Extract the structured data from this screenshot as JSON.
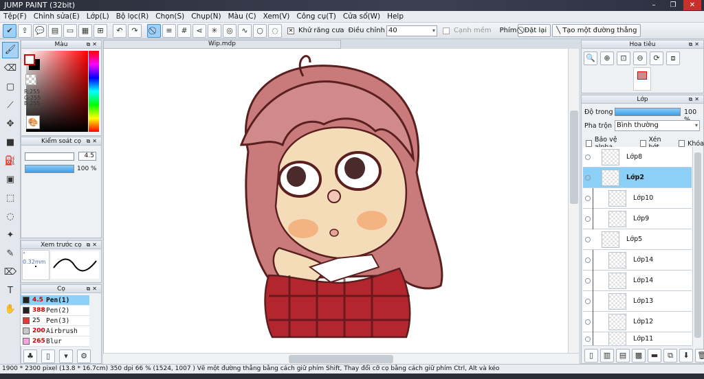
{
  "window": {
    "title": "JUMP PAINT (32bit)",
    "controls": [
      "–",
      "❐",
      "✕"
    ]
  },
  "menu": [
    "Tệp(F)",
    "Chỉnh sửa(E)",
    "Lớp(L)",
    "Bộ lọc(R)",
    "Chọn(S)",
    "Chụp(N)",
    "Màu (C)",
    "Xem(V)",
    "Công cụ(T)",
    "Cửa sổ(W)",
    "Help"
  ],
  "toolbar": {
    "antialias_label": "Khử răng cưa",
    "adjust_label": "Điều chỉnh",
    "adjust_value": "40",
    "edge_label": "Cạnh mềm",
    "key_label": "Phím",
    "reset_label": "Đặt lại",
    "straight_line_label": "Tạo một đường thẳng"
  },
  "color_panel": {
    "title": "Màu",
    "r": "R:255",
    "g": "G:255",
    "b": "B:255"
  },
  "brush_control": {
    "title": "Kiểm soát cọ",
    "size": "4.5",
    "opacity": "100 %",
    "opacity_fraction": 1.0
  },
  "brush_preview": {
    "title": "Xem trước cọ",
    "size_label": "° 0.32mm"
  },
  "brushes": {
    "title": "Cọ",
    "items": [
      {
        "size": "4.5",
        "name": "Pen(1)",
        "color": "#222222",
        "selected": true
      },
      {
        "size": "388",
        "name": "Pen(2)",
        "color": "#222222",
        "selected": false
      },
      {
        "size": "25",
        "name": "Pen(3)",
        "color": "#e23a3a",
        "selected": false
      },
      {
        "size": "200",
        "name": "Airbrush",
        "color": "#c8c8c8",
        "selected": false
      },
      {
        "size": "265",
        "name": "Blur",
        "color": "#f6a6e0",
        "selected": false
      }
    ]
  },
  "document": {
    "tab": "Wip.mdp"
  },
  "navigator": {
    "title": "Hoa tiêu"
  },
  "layers_panel": {
    "title": "Lớp",
    "opacity_label": "Độ trong",
    "opacity_value": "100 %",
    "opacity_fraction": 1.0,
    "blend_label": "Pha trộn",
    "blend_value": "Bình thường",
    "protect_alpha": "Bảo vệ alpha",
    "clipping": "Xén bớt",
    "lock": "Khóa",
    "items": [
      {
        "name": "Lớp8",
        "selected": false,
        "clipped": false
      },
      {
        "name": "Lớp2",
        "selected": true,
        "clipped": false
      },
      {
        "name": "Lớp10",
        "selected": false,
        "clipped": true
      },
      {
        "name": "Lớp9",
        "selected": false,
        "clipped": true
      },
      {
        "name": "Lớp5",
        "selected": false,
        "clipped": false
      },
      {
        "name": "Lớp14",
        "selected": false,
        "clipped": true
      },
      {
        "name": "Lớp14",
        "selected": false,
        "clipped": true
      },
      {
        "name": "Lớp13",
        "selected": false,
        "clipped": true
      },
      {
        "name": "Lớp12",
        "selected": false,
        "clipped": true
      },
      {
        "name": "Lớp11",
        "selected": false,
        "clipped": true
      }
    ]
  },
  "status": {
    "text": "1900 * 2300 pixel  (13.8 * 16.7cm)  350 dpi  66 %  (1524, 1007 )  Vẽ một đường thẳng bằng cách giữ phím Shift, Thay đổi cỡ cọ bằng cách giữ phím Ctrl, Alt và kéo"
  },
  "icons": {
    "accent": "#3a8fd8",
    "selection": "#8cd0f8"
  }
}
